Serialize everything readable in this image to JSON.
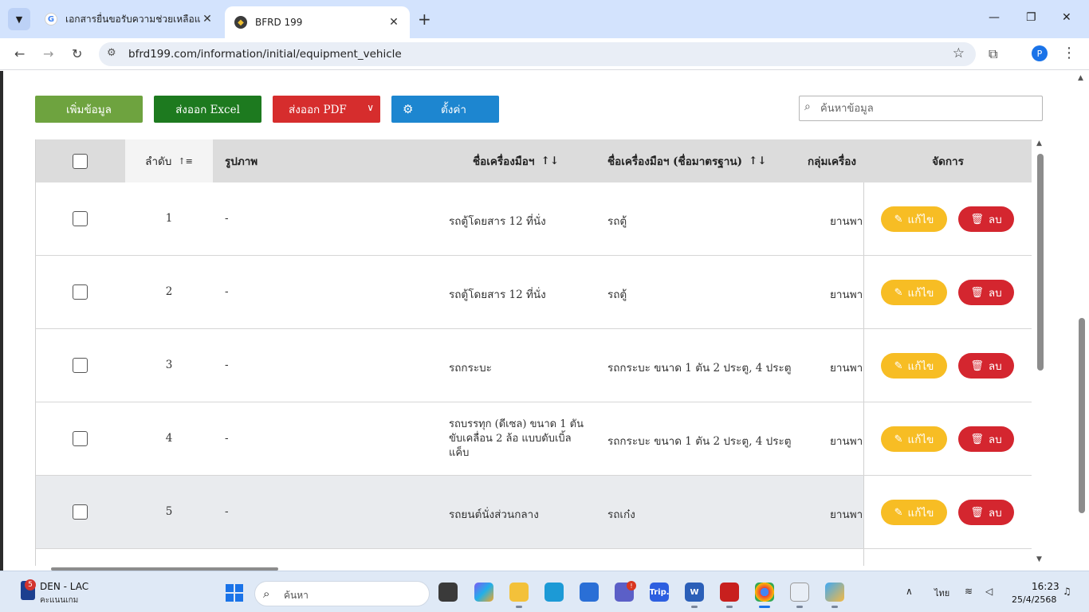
{
  "browser": {
    "tabs": [
      {
        "title": "เอกสารยื่นขอรับความช่วยเหลือแม่นลิ",
        "favicon": "google-favicon"
      },
      {
        "title": "BFRD 199",
        "favicon": "bfrd-favicon"
      }
    ],
    "url": "bfrd199.com/information/initial/equipment_vehicle",
    "profile_initial": "P",
    "favicon_glyphs": {
      "google": "G",
      "bfrd": "◆"
    },
    "icons": {
      "tab_menu": "chevron-down-icon",
      "close": "close-icon",
      "new_tab": "plus-icon",
      "back": "back-arrow-icon",
      "forward": "forward-arrow-icon",
      "reload": "reload-icon",
      "site_info": "site-info-icon",
      "bookmark": "star-icon",
      "extensions": "puzzle-icon",
      "menu": "more-vert-icon"
    }
  },
  "toolbar": {
    "add_label": "เพิ่มข้อมูล",
    "excel_label": "ส่งออก Excel",
    "pdf_label": "ส่งออก PDF",
    "settings_label": "ตั้งค่า"
  },
  "search": {
    "placeholder": "ค้นหาข้อมูล"
  },
  "table": {
    "headers": {
      "order": "ลำดับ",
      "image": "รูปภาพ",
      "name": "ชื่อเครื่องมือฯ",
      "standard_name": "ชื่อเครื่องมือฯ (ชื่อมาตรฐาน)",
      "group": "กลุ่มเครื่อง",
      "manage": "จัดการ"
    },
    "sort_glyphs": {
      "order": "↑≡",
      "name": "↑↓",
      "standard_name": "↑↓"
    },
    "edit_label": "แก้ไข",
    "delete_label": "ลบ",
    "rows": [
      {
        "order": "1",
        "image": "-",
        "name": "รถตู้โดยสาร 12 ที่นั่ง",
        "standard_name": "รถตู้",
        "group": "ยานพา"
      },
      {
        "order": "2",
        "image": "-",
        "name": "รถตู้โดยสาร 12 ที่นั่ง",
        "standard_name": "รถตู้",
        "group": "ยานพา"
      },
      {
        "order": "3",
        "image": "-",
        "name": "รถกระบะ",
        "standard_name": "รถกระบะ ขนาด 1 ตัน 2 ประตู, 4 ประตู",
        "group": "ยานพา"
      },
      {
        "order": "4",
        "image": "-",
        "name": "รถบรรทุก (ดีเซล) ขนาด 1 ตัน ขับเคลื่อน 2 ล้อ แบบดับเบิ้ลแค็บ",
        "standard_name": "รถกระบะ ขนาด 1 ตัน 2 ประตู, 4 ประตู",
        "group": "ยานพา"
      },
      {
        "order": "5",
        "image": "-",
        "name": "รถยนต์นั่งส่วนกลาง",
        "standard_name": "รถเก๋ง",
        "group": "ยานพา"
      }
    ]
  },
  "taskbar": {
    "weather_title": "DEN - LAC",
    "weather_sub": "คะแนนเกม",
    "weather_badge": "5",
    "search_placeholder": "ค้นหา",
    "teams_badge": "!",
    "tripadvisor_label": "Trip.",
    "word_label": "W",
    "language": "ไทย",
    "time": "16:23",
    "date": "25/4/2568"
  }
}
